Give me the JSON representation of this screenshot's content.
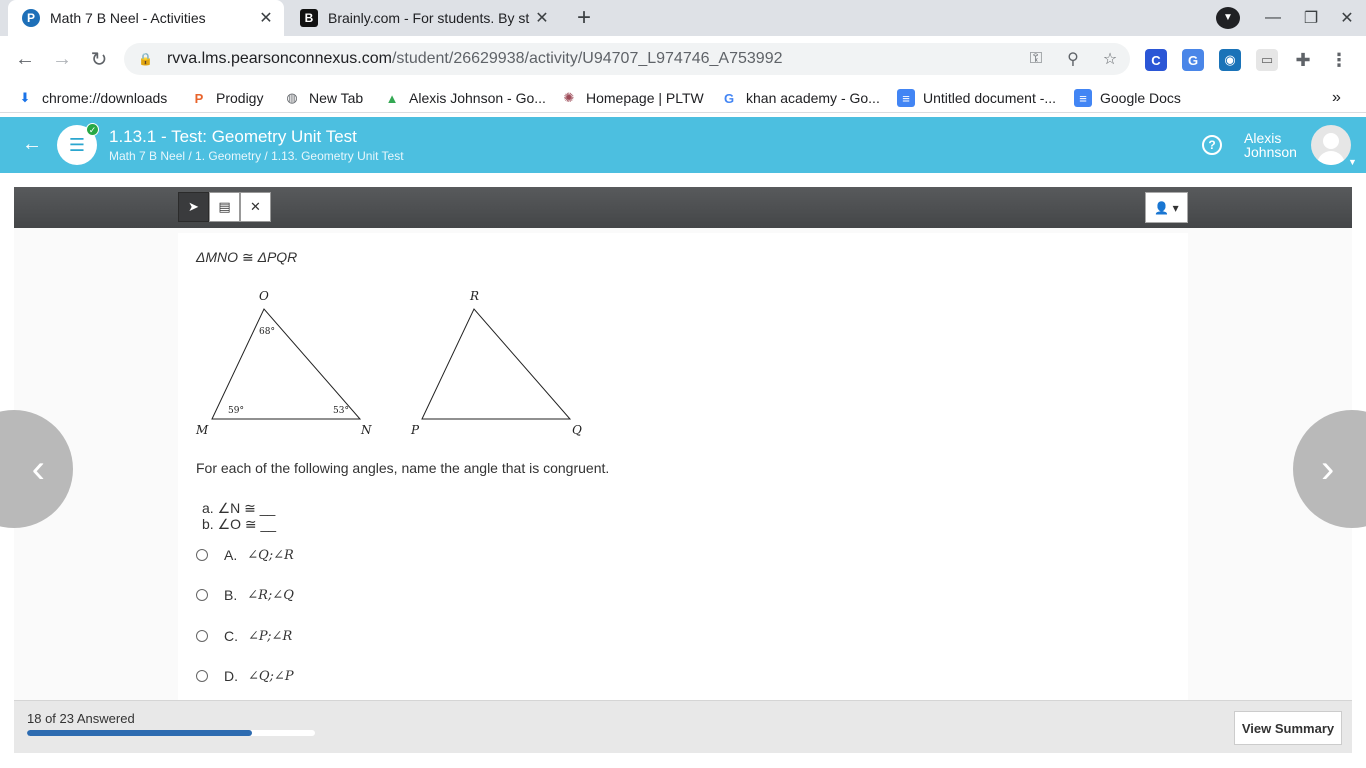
{
  "browser": {
    "tabs": [
      {
        "title": "Math 7 B Neel - Activities",
        "favicon": "pearson-p-icon",
        "active": true
      },
      {
        "title": "Brainly.com - For students. By stu",
        "favicon": "brainly-b-icon",
        "active": false
      }
    ],
    "url_host": "rvva.lms.pearsonconnexus.com",
    "url_path": "/student/26629938/activity/U94707_L974746_A753992",
    "bookmarks": [
      {
        "label": "chrome://downloads",
        "icon": "download-icon"
      },
      {
        "label": "Prodigy",
        "icon": "prodigy-icon"
      },
      {
        "label": "New Tab",
        "icon": "globe-icon"
      },
      {
        "label": "Alexis Johnson - Go...",
        "icon": "google-drive-icon"
      },
      {
        "label": "Homepage | PLTW",
        "icon": "pltw-icon"
      },
      {
        "label": "khan academy - Go...",
        "icon": "google-icon"
      },
      {
        "label": "Untitled document -...",
        "icon": "google-docs-icon"
      },
      {
        "label": "Google Docs",
        "icon": "google-docs-icon"
      }
    ],
    "more_bookmarks": "»"
  },
  "app": {
    "title": "1.13.1 - Test: Geometry Unit Test",
    "breadcrumb": "Math 7 B Neel / 1. Geometry / 1.13. Geometry Unit Test",
    "user_first": "Alexis",
    "user_last": "Johnson",
    "header_color": "#4cbfe0"
  },
  "question": {
    "stem": "ΔMNO ≅ ΔPQR",
    "figure": {
      "triangle1": {
        "top": "O",
        "left": "M",
        "right": "N",
        "angle_top": "68°",
        "angle_left": "59°",
        "angle_right": "53°"
      },
      "triangle2": {
        "top": "R",
        "left": "P",
        "right": "Q"
      }
    },
    "prompt": "For each of the following angles, name the angle that is congruent.",
    "part_a": "a. ∠N ≅ __",
    "part_b": "b. ∠O ≅ __",
    "options": [
      {
        "letter": "A.",
        "text": "∠Q;∠R"
      },
      {
        "letter": "B.",
        "text": "∠R;∠Q"
      },
      {
        "letter": "C.",
        "text": "∠P;∠R"
      },
      {
        "letter": "D.",
        "text": "∠Q;∠P"
      }
    ]
  },
  "footer": {
    "progress_text": "18 of 23 Answered",
    "answered": 18,
    "total": 23,
    "summary_label": "View Summary"
  }
}
